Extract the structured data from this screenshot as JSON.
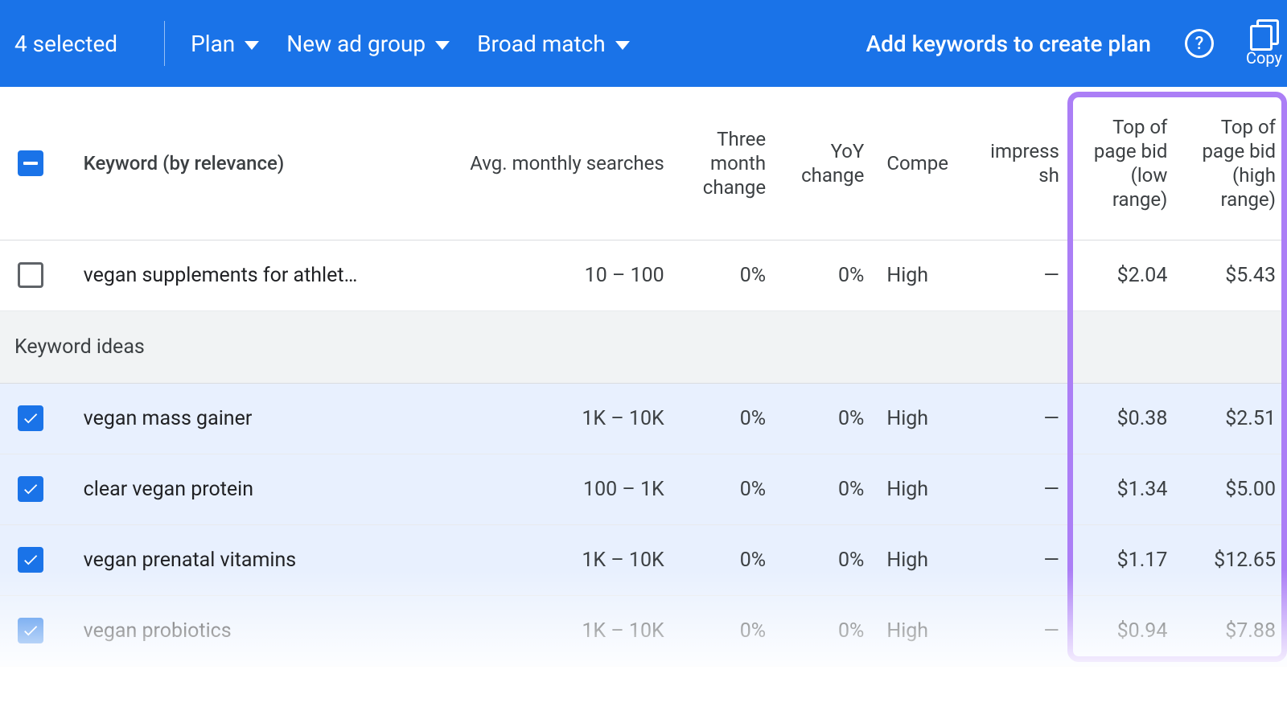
{
  "toolbar": {
    "selected_count": "4 selected",
    "plan_label": "Plan",
    "adgroup_label": "New ad group",
    "match_label": "Broad match",
    "cta": "Add keywords to create plan",
    "copy_label": "Copy"
  },
  "columns": {
    "keyword": "Keyword (by relevance)",
    "avg": "Avg. monthly searches",
    "three_month": "Three month change",
    "yoy": "YoY change",
    "competition": "Compe",
    "impr_share": "impress sh",
    "bid_low": "Top of page bid (low range)",
    "bid_high": "Top of page bid (high range)"
  },
  "section_label": "Keyword ideas",
  "rows": [
    {
      "checked": false,
      "keyword": "vegan supplements for athlet…",
      "avg": "10 – 100",
      "three": "0%",
      "yoy": "0%",
      "comp": "High",
      "imp": "—",
      "low": "$2.04",
      "high": "$5.43"
    }
  ],
  "ideas": [
    {
      "checked": true,
      "keyword": "vegan mass gainer",
      "avg": "1K – 10K",
      "three": "0%",
      "yoy": "0%",
      "comp": "High",
      "imp": "—",
      "low": "$0.38",
      "high": "$2.51"
    },
    {
      "checked": true,
      "keyword": "clear vegan protein",
      "avg": "100 – 1K",
      "three": "0%",
      "yoy": "0%",
      "comp": "High",
      "imp": "—",
      "low": "$1.34",
      "high": "$5.00"
    },
    {
      "checked": true,
      "keyword": "vegan prenatal vitamins",
      "avg": "1K – 10K",
      "three": "0%",
      "yoy": "0%",
      "comp": "High",
      "imp": "—",
      "low": "$1.17",
      "high": "$12.65"
    },
    {
      "checked": true,
      "keyword": "vegan probiotics",
      "avg": "1K – 10K",
      "three": "0%",
      "yoy": "0%",
      "comp": "High",
      "imp": "—",
      "low": "$0.94",
      "high": "$7.88"
    }
  ]
}
